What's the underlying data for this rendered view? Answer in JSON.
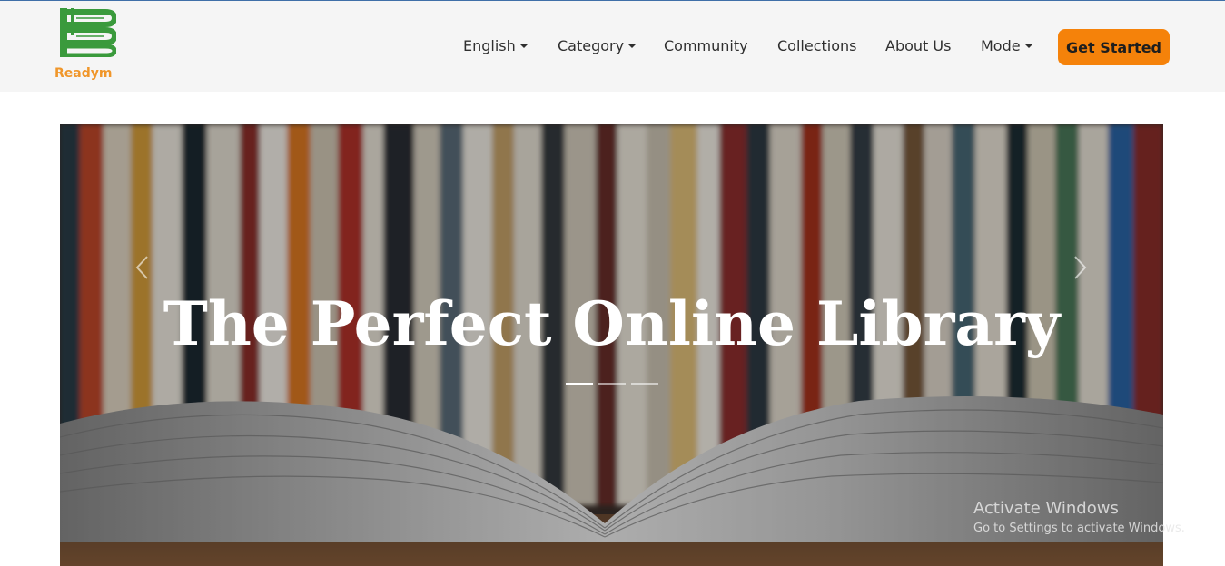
{
  "brand": {
    "name": "Readym"
  },
  "nav": {
    "items": [
      {
        "label": "English",
        "dropdown": true
      },
      {
        "label": "Category",
        "dropdown": true
      },
      {
        "label": "Community",
        "dropdown": false
      },
      {
        "label": "Collections",
        "dropdown": false
      },
      {
        "label": "About Us",
        "dropdown": false
      },
      {
        "label": "Mode",
        "dropdown": true
      }
    ],
    "cta_label": "Get Started"
  },
  "hero": {
    "title": "The Perfect Online Library",
    "slides_count": 3,
    "active_slide": 1
  },
  "watermark": {
    "title": "Activate Windows",
    "subtitle": "Go to Settings to activate Windows."
  },
  "colors": {
    "accent": "#f5820a",
    "logo_green": "#3a9a3c",
    "logo_text": "#f0962a",
    "navbar_bg": "#f5f5f5"
  }
}
